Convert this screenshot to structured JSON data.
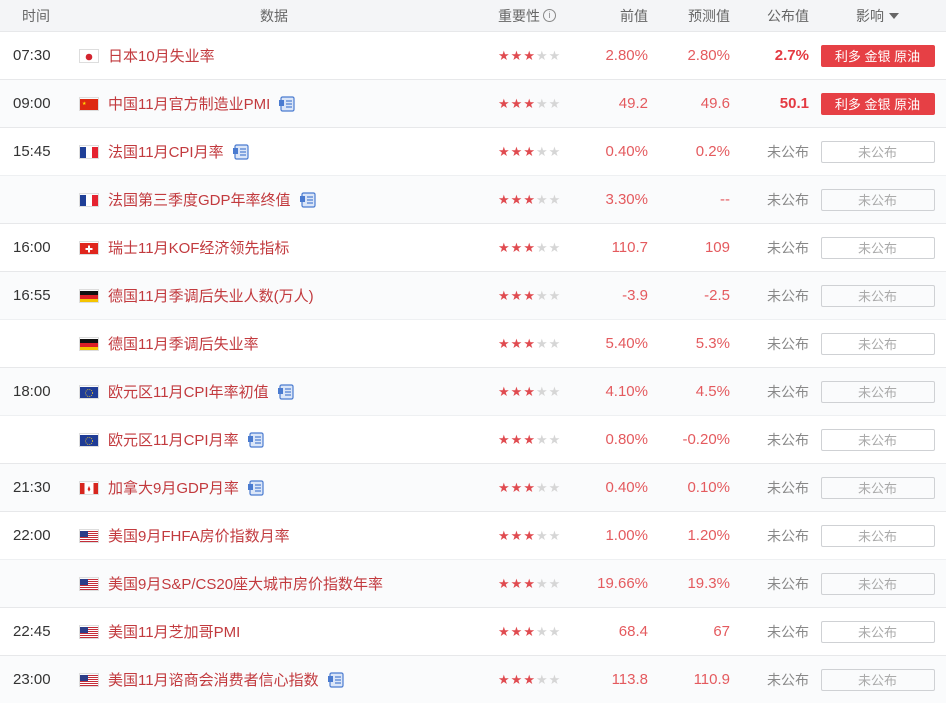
{
  "header": {
    "time": "时间",
    "data": "数据",
    "importance": "重要性",
    "previous": "前值",
    "forecast": "预测值",
    "published": "公布值",
    "impact": "影响"
  },
  "rows": [
    {
      "time": "07:30",
      "flag": "jp",
      "name": "日本10月失业率",
      "doc": false,
      "stars": 3,
      "prev": "2.80%",
      "fore": "2.80%",
      "pub": "2.7%",
      "pub_style": "released",
      "impact": "利多 金银 原油",
      "impact_style": "red"
    },
    {
      "time": "09:00",
      "flag": "cn",
      "name": "中国11月官方制造业PMI",
      "doc": true,
      "stars": 3,
      "prev": "49.2",
      "fore": "49.6",
      "pub": "50.1",
      "pub_style": "released",
      "impact": "利多 金银 原油",
      "impact_style": "red"
    },
    {
      "time": "15:45",
      "flag": "fr",
      "name": "法国11月CPI月率",
      "doc": true,
      "stars": 3,
      "prev": "0.40%",
      "fore": "0.2%",
      "pub": "未公布",
      "pub_style": "pending",
      "impact": "未公布",
      "impact_style": "gray"
    },
    {
      "time": "",
      "flag": "fr",
      "name": "法国第三季度GDP年率终值",
      "doc": true,
      "stars": 3,
      "prev": "3.30%",
      "fore": "--",
      "pub": "未公布",
      "pub_style": "pending",
      "impact": "未公布",
      "impact_style": "gray"
    },
    {
      "time": "16:00",
      "flag": "ch",
      "name": "瑞士11月KOF经济领先指标",
      "doc": false,
      "stars": 3,
      "prev": "110.7",
      "fore": "109",
      "pub": "未公布",
      "pub_style": "pending",
      "impact": "未公布",
      "impact_style": "gray"
    },
    {
      "time": "16:55",
      "flag": "de",
      "name": "德国11月季调后失业人数(万人)",
      "doc": false,
      "stars": 3,
      "prev": "-3.9",
      "fore": "-2.5",
      "pub": "未公布",
      "pub_style": "pending",
      "impact": "未公布",
      "impact_style": "gray"
    },
    {
      "time": "",
      "flag": "de",
      "name": "德国11月季调后失业率",
      "doc": false,
      "stars": 3,
      "prev": "5.40%",
      "fore": "5.3%",
      "pub": "未公布",
      "pub_style": "pending",
      "impact": "未公布",
      "impact_style": "gray"
    },
    {
      "time": "18:00",
      "flag": "eu",
      "name": "欧元区11月CPI年率初值",
      "doc": true,
      "stars": 3,
      "prev": "4.10%",
      "fore": "4.5%",
      "pub": "未公布",
      "pub_style": "pending",
      "impact": "未公布",
      "impact_style": "gray"
    },
    {
      "time": "",
      "flag": "eu",
      "name": "欧元区11月CPI月率",
      "doc": true,
      "stars": 3,
      "prev": "0.80%",
      "fore": "-0.20%",
      "pub": "未公布",
      "pub_style": "pending",
      "impact": "未公布",
      "impact_style": "gray"
    },
    {
      "time": "21:30",
      "flag": "ca",
      "name": "加拿大9月GDP月率",
      "doc": true,
      "stars": 3,
      "prev": "0.40%",
      "fore": "0.10%",
      "pub": "未公布",
      "pub_style": "pending",
      "impact": "未公布",
      "impact_style": "gray"
    },
    {
      "time": "22:00",
      "flag": "us",
      "name": "美国9月FHFA房价指数月率",
      "doc": false,
      "stars": 3,
      "prev": "1.00%",
      "fore": "1.20%",
      "pub": "未公布",
      "pub_style": "pending",
      "impact": "未公布",
      "impact_style": "gray"
    },
    {
      "time": "",
      "flag": "us",
      "name": "美国9月S&P/CS20座大城市房价指数年率",
      "doc": false,
      "stars": 3,
      "prev": "19.66%",
      "fore": "19.3%",
      "pub": "未公布",
      "pub_style": "pending",
      "impact": "未公布",
      "impact_style": "gray"
    },
    {
      "time": "22:45",
      "flag": "us",
      "name": "美国11月芝加哥PMI",
      "doc": false,
      "stars": 3,
      "prev": "68.4",
      "fore": "67",
      "pub": "未公布",
      "pub_style": "pending",
      "impact": "未公布",
      "impact_style": "gray"
    },
    {
      "time": "23:00",
      "flag": "us",
      "name": "美国11月谘商会消费者信心指数",
      "doc": true,
      "stars": 3,
      "prev": "113.8",
      "fore": "110.9",
      "pub": "未公布",
      "pub_style": "pending",
      "impact": "未公布",
      "impact_style": "gray"
    }
  ],
  "colors": {
    "accent": "#e64045",
    "name": "#c23a3e",
    "value": "#e45a5e",
    "star_off": "#d6d6d6"
  }
}
